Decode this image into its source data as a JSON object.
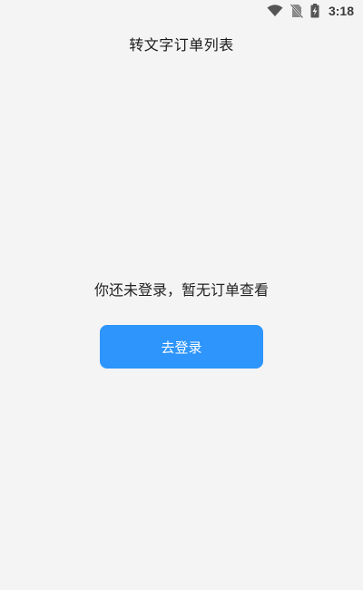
{
  "status_bar": {
    "time": "3:18",
    "icons": [
      "wifi-icon",
      "no-sim-icon",
      "battery-charging-icon"
    ]
  },
  "header": {
    "title": "转文字订单列表"
  },
  "main": {
    "empty_message": "你还未登录，暂无订单查看",
    "login_button_label": "去登录"
  },
  "colors": {
    "background": "#f4f4f4",
    "accent": "#2d95fb",
    "button_text": "#ffffff"
  }
}
